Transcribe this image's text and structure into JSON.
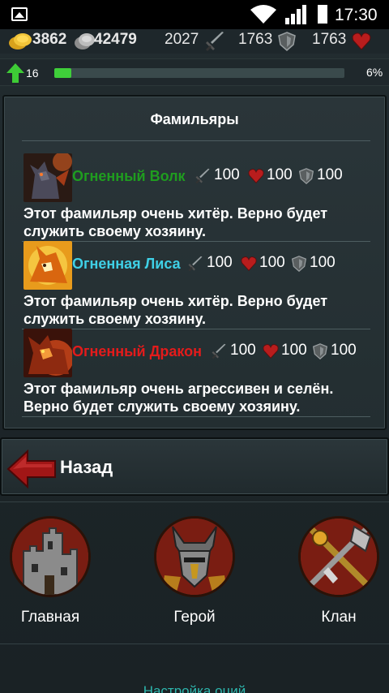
{
  "status_bar": {
    "time": "17:30"
  },
  "resources": {
    "gold": "3862",
    "silver": "42479",
    "attack": "2027",
    "defense": "1763",
    "health": "1763"
  },
  "level": {
    "value": "16",
    "progress_percent_text": "6%",
    "progress_fraction": 0.06
  },
  "panel": {
    "title": "Фамильяры",
    "familiars": [
      {
        "name": "Огненный Волк",
        "name_color": "#1f9d1f",
        "attack": "100",
        "health": "100",
        "defense": "100",
        "description_line1": "Этот фамильяр очень хитёр. Верно будет",
        "description_line2": "служить своему хозяину."
      },
      {
        "name": "Огненная Лиса",
        "name_color": "#3fd0e6",
        "attack": "100",
        "health": "100",
        "defense": "100",
        "description_line1": "Этот фамильяр очень хитёр. Верно будет",
        "description_line2": "служить своему хозяину."
      },
      {
        "name": "Огненный Дракон",
        "name_color": "#e31b1b",
        "attack": "100",
        "health": "100",
        "defense": "100",
        "description_line1": "Этот фамильяр очень агрессивен и селён.",
        "description_line2": "Верно будет служить своему хозяину."
      }
    ]
  },
  "back_button": {
    "label": "Назад"
  },
  "nav": {
    "home": "Главная",
    "hero": "Герой",
    "clan": "Клан"
  },
  "footer": {
    "settings_link": "Настройка оций"
  },
  "colors": {
    "accent_teal": "#2db6ad",
    "xp_green": "#3fcf3a"
  }
}
